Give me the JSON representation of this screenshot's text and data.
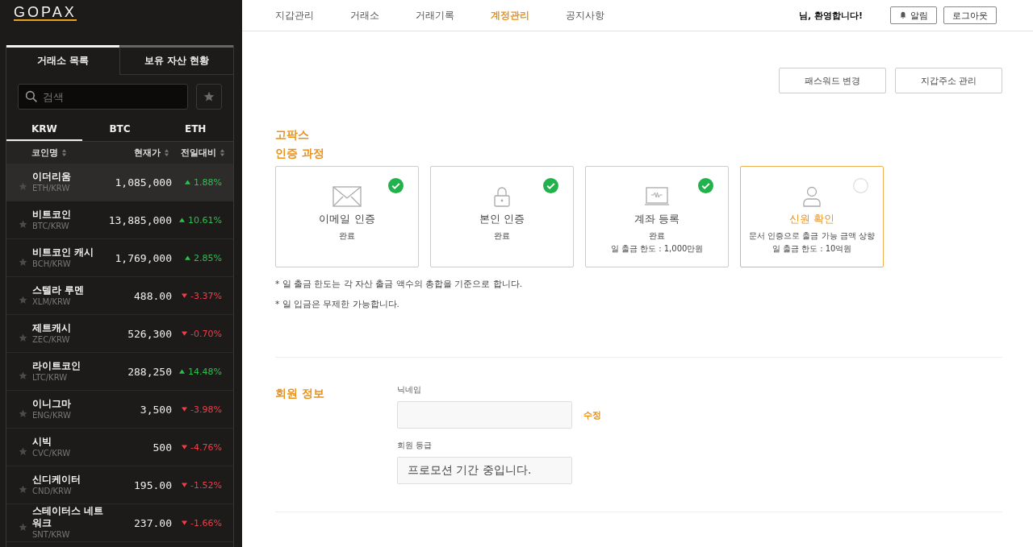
{
  "logo": "GOPAX",
  "sidebar": {
    "tabs": [
      {
        "label": "거래소 목록",
        "selected": true
      },
      {
        "label": "보유 자산 현황",
        "selected": false
      }
    ],
    "search": {
      "placeholder": "검색"
    },
    "markets": [
      {
        "label": "KRW",
        "selected": true
      },
      {
        "label": "BTC",
        "selected": false
      },
      {
        "label": "ETH",
        "selected": false
      }
    ],
    "columns": [
      "코인명",
      "현재가",
      "전일대비"
    ],
    "rows": [
      {
        "name": "이더리움",
        "pair": "ETH/KRW",
        "price": "1,085,000",
        "change": "1.88%",
        "rising": true,
        "selected": true
      },
      {
        "name": "비트코인",
        "pair": "BTC/KRW",
        "price": "13,885,000",
        "change": "10.61%",
        "rising": true,
        "selected": false
      },
      {
        "name": "비트코인 캐시",
        "pair": "BCH/KRW",
        "price": "1,769,000",
        "change": "2.85%",
        "rising": true,
        "selected": false
      },
      {
        "name": "스텔라 루멘",
        "pair": "XLM/KRW",
        "price": "488.00",
        "change": "-3.37%",
        "rising": false,
        "selected": false
      },
      {
        "name": "제트캐시",
        "pair": "ZEC/KRW",
        "price": "526,300",
        "change": "-0.70%",
        "rising": false,
        "selected": false
      },
      {
        "name": "라이트코인",
        "pair": "LTC/KRW",
        "price": "288,250",
        "change": "14.48%",
        "rising": true,
        "selected": false
      },
      {
        "name": "이니그마",
        "pair": "ENG/KRW",
        "price": "3,500",
        "change": "-3.98%",
        "rising": false,
        "selected": false
      },
      {
        "name": "시빅",
        "pair": "CVC/KRW",
        "price": "500",
        "change": "-4.76%",
        "rising": false,
        "selected": false
      },
      {
        "name": "신디케이터",
        "pair": "CND/KRW",
        "price": "195.00",
        "change": "-1.52%",
        "rising": false,
        "selected": false
      },
      {
        "name": "스테이터스 네트워크",
        "pair": "SNT/KRW",
        "price": "237.00",
        "change": "-1.66%",
        "rising": false,
        "selected": false
      }
    ]
  },
  "nav": [
    {
      "label": "지갑관리",
      "selected": false
    },
    {
      "label": "거래소",
      "selected": false
    },
    {
      "label": "거래기록",
      "selected": false
    },
    {
      "label": "계정관리",
      "selected": true
    },
    {
      "label": "공지사항",
      "selected": false
    }
  ],
  "welcome": "님, 환영합니다!",
  "header_buttons": [
    "알림",
    "로그아웃"
  ],
  "action_buttons": [
    "패스워드 변경",
    "지갑주소 관리"
  ],
  "verification": {
    "title_lines": [
      "고팍스",
      "인증 과정"
    ],
    "steps": [
      {
        "title": "이메일 인증",
        "lines": [
          "완료"
        ],
        "done": true,
        "current": false
      },
      {
        "title": "본인 인증",
        "lines": [
          "완료"
        ],
        "done": true,
        "current": false
      },
      {
        "title": "계좌 등록",
        "lines": [
          "완료",
          "일 출금 한도 : 1,000만원"
        ],
        "done": true,
        "current": false
      },
      {
        "title": "신원 확인",
        "lines": [
          "문서 인증으로 출금 가능 금액 상향",
          "일 출금 한도 : 10억원"
        ],
        "done": false,
        "current": true
      }
    ],
    "notes": [
      "* 일 출금 한도는 각 자산 출금 액수의 총합을 기준으로 합니다.",
      "* 일 입금은 무제한 가능합니다."
    ]
  },
  "member": {
    "title": "회원 정보",
    "nickname_label": "닉네임",
    "edit_link": "수정",
    "grade_label": "회원 등급",
    "grade_value": "프로모션 기간 중입니다."
  }
}
